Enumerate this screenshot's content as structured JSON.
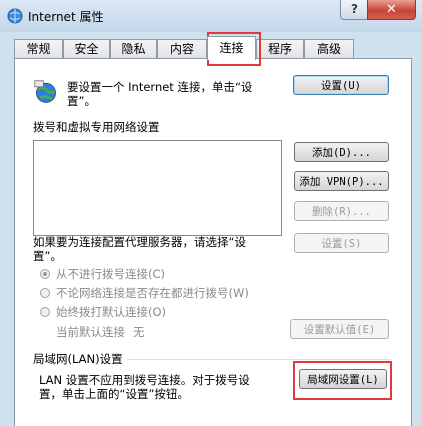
{
  "window": {
    "title": "Internet 属性",
    "help_label": "?",
    "close_label": "✕"
  },
  "tabs": [
    {
      "label": "常规"
    },
    {
      "label": "安全"
    },
    {
      "label": "隐私"
    },
    {
      "label": "内容"
    },
    {
      "label": "连接",
      "active": true
    },
    {
      "label": "程序"
    },
    {
      "label": "高级"
    }
  ],
  "setup": {
    "text_line1": "要设置一个 Internet 连接，单击“设",
    "text_line2": "置”。",
    "button": "设置(U)"
  },
  "dialup": {
    "section_title": "拨号和虚拟专用网络设置",
    "add_button": "添加(D)...",
    "add_vpn_button": "添加 VPN(P)...",
    "delete_button": "删除(R)...",
    "proxy_text_line1": "如果要为连接配置代理服务器，请选择“设",
    "proxy_text_line2": "置”。",
    "settings_button": "设置(S)",
    "options": [
      {
        "label": "从不进行拨号连接(C)",
        "checked": true
      },
      {
        "label": "不论网络连接是否存在都进行拨号(W)",
        "checked": false
      },
      {
        "label": "始终拨打默认连接(O)",
        "checked": false
      }
    ],
    "current_default_label": "当前默认连接",
    "current_default_value": "无",
    "set_default_button": "设置默认值(E)"
  },
  "lan": {
    "section_title": "局域网(LAN)设置",
    "text_line1": "LAN 设置不应用到拨号连接。对于拨号设",
    "text_line2": "置，单击上面的“设置”按钮。",
    "button": "局域网设置(L)"
  }
}
